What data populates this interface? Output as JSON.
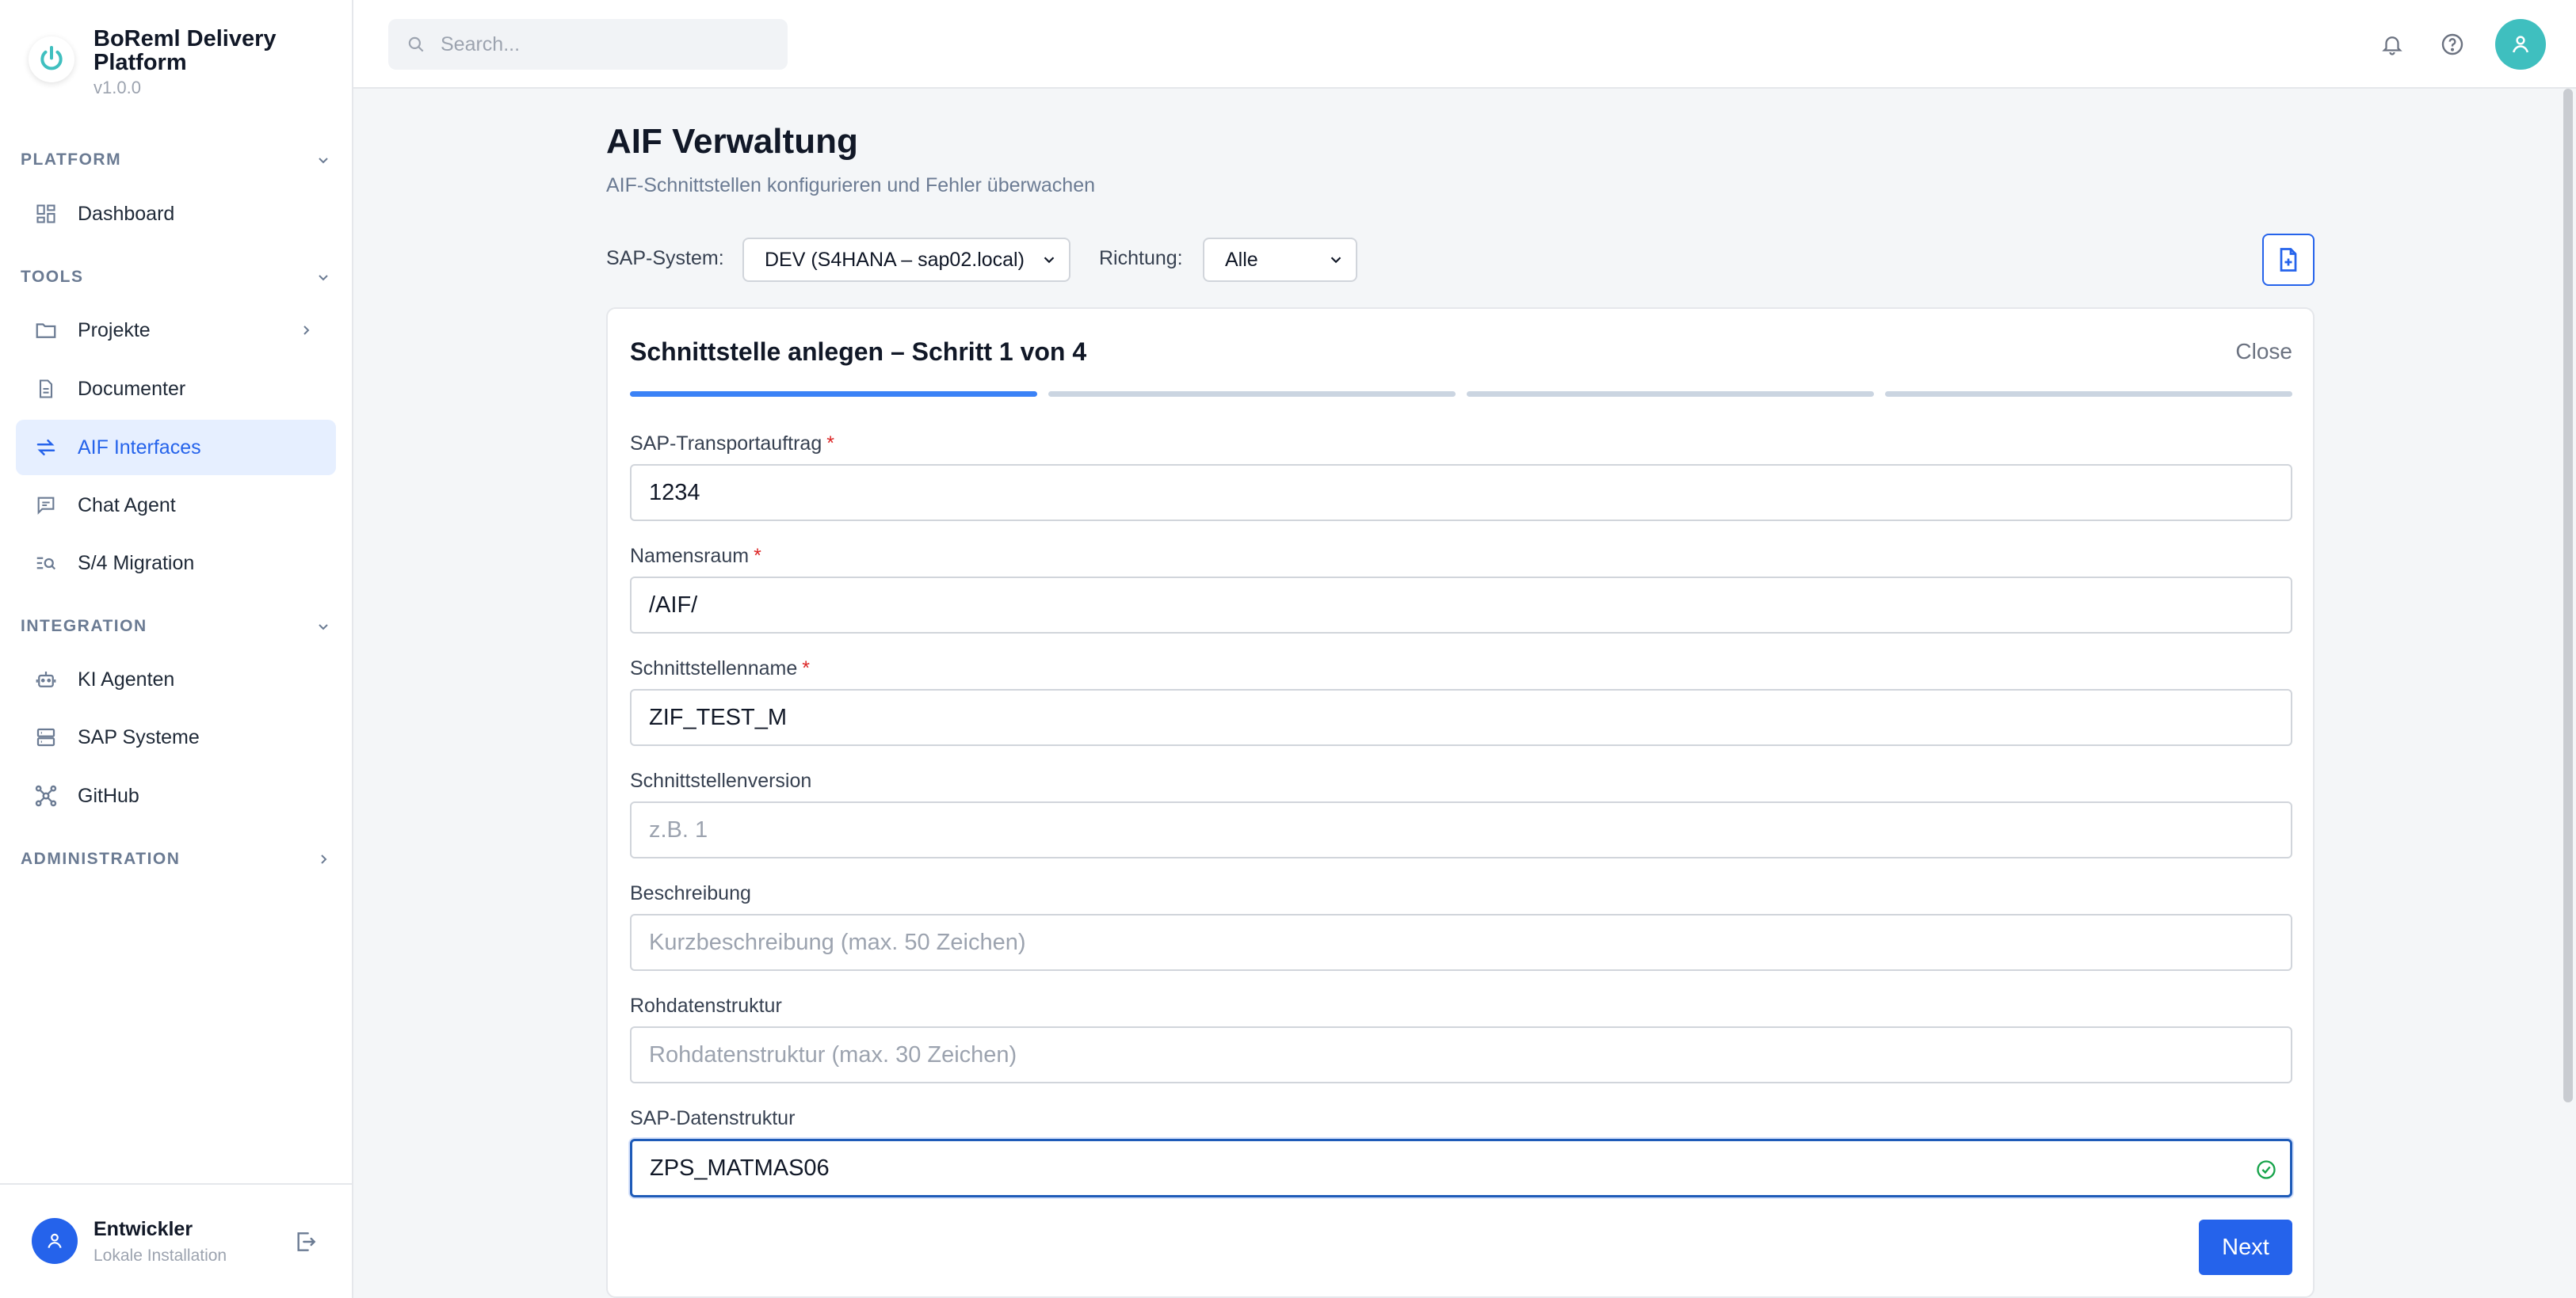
{
  "brand": {
    "title": "BoReml Delivery Platform",
    "version": "v1.0.0"
  },
  "sidebar": {
    "sections": [
      {
        "label": "PLATFORM"
      },
      {
        "label": "TOOLS"
      },
      {
        "label": "INTEGRATION"
      },
      {
        "label": "ADMINISTRATION"
      }
    ],
    "items": [
      {
        "label": "Dashboard",
        "icon": "dashboard-icon"
      },
      {
        "label": "Projekte",
        "icon": "folder-icon"
      },
      {
        "label": "Documenter",
        "icon": "document-icon"
      },
      {
        "label": "AIF Interfaces",
        "icon": "arrows-exchange-icon",
        "active": true
      },
      {
        "label": "Chat Agent",
        "icon": "chat-icon"
      },
      {
        "label": "S/4 Migration",
        "icon": "list-search-icon"
      },
      {
        "label": "KI Agenten",
        "icon": "robot-icon"
      },
      {
        "label": "SAP Systeme",
        "icon": "server-icon"
      },
      {
        "label": "GitHub",
        "icon": "network-icon"
      }
    ]
  },
  "user": {
    "name": "Entwickler",
    "subtitle": "Lokale Installation"
  },
  "topbar": {
    "search_placeholder": "Search..."
  },
  "page": {
    "title": "AIF Verwaltung",
    "subtitle": "AIF-Schnittstellen konfigurieren und Fehler überwachen"
  },
  "filters": {
    "sap_system_label": "SAP-System:",
    "sap_system_value": "DEV (S4HANA – sap02.local)",
    "direction_label": "Richtung:",
    "direction_value": "Alle"
  },
  "wizard": {
    "title": "Schnittstelle anlegen – Schritt 1 von 4",
    "close_label": "Close",
    "current_step": 1,
    "total_steps": 4,
    "fields": [
      {
        "label": "SAP-Transportauftrag",
        "required": "*",
        "value": "1234",
        "placeholder": ""
      },
      {
        "label": "Namensraum",
        "required": "*",
        "value": "/AIF/",
        "placeholder": ""
      },
      {
        "label": "Schnittstellenname",
        "required": "*",
        "value": "ZIF_TEST_M",
        "placeholder": ""
      },
      {
        "label": "Schnittstellenversion",
        "required": "",
        "value": "",
        "placeholder": "z.B. 1"
      },
      {
        "label": "Beschreibung",
        "required": "",
        "value": "",
        "placeholder": "Kurzbeschreibung (max. 50 Zeichen)"
      },
      {
        "label": "Rohdatenstruktur",
        "required": "",
        "value": "",
        "placeholder": "Rohdatenstruktur (max. 30 Zeichen)"
      },
      {
        "label": "SAP-Datenstruktur",
        "required": "",
        "value": "ZPS_MATMAS06",
        "placeholder": ""
      }
    ],
    "next_label": "Next"
  },
  "colors": {
    "accent": "#2563eb",
    "avatar": "#3fbfbf",
    "required": "#dc2626",
    "valid": "#16a34a"
  }
}
